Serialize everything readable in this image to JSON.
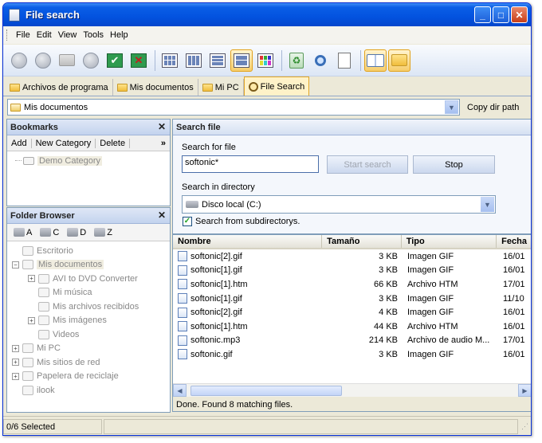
{
  "window": {
    "title": "File search"
  },
  "menu": [
    "File",
    "Edit",
    "View",
    "Tools",
    "Help"
  ],
  "toolbar": {
    "icons": [
      "back-icon",
      "forward-icon",
      "up-folder-icon",
      "refresh-icon",
      "check-icon",
      "cancel-icon",
      "large-icons-view-icon",
      "small-icons-view-icon",
      "list-view-icon",
      "details-view-icon",
      "thumbnails-view-icon",
      "recycle-icon",
      "search-icon",
      "properties-icon",
      "open-book-icon",
      "folder-icon"
    ]
  },
  "tabs": [
    "Archivos de programa",
    "Mis documentos",
    "Mi PC",
    "File Search"
  ],
  "path": {
    "value": "Mis documentos",
    "copy_label": "Copy dir path"
  },
  "bookmarks": {
    "title": "Bookmarks",
    "buttons": [
      "Add",
      "New Category",
      "Delete"
    ],
    "more": "»",
    "items": [
      "Demo Category"
    ]
  },
  "folder_browser": {
    "title": "Folder Browser",
    "drives": [
      "A",
      "C",
      "D",
      "Z"
    ],
    "tree": [
      {
        "label": "Escritorio",
        "level": 0,
        "toggle": ""
      },
      {
        "label": "Mis documentos",
        "level": 0,
        "toggle": "−",
        "selected": true
      },
      {
        "label": "AVI to DVD Converter",
        "level": 1,
        "toggle": "+"
      },
      {
        "label": "Mi música",
        "level": 1,
        "toggle": ""
      },
      {
        "label": "Mis archivos recibidos",
        "level": 1,
        "toggle": ""
      },
      {
        "label": "Mis imágenes",
        "level": 1,
        "toggle": "+"
      },
      {
        "label": "Videos",
        "level": 1,
        "toggle": ""
      },
      {
        "label": "Mi PC",
        "level": 0,
        "toggle": "+"
      },
      {
        "label": "Mis sitios de red",
        "level": 0,
        "toggle": "+"
      },
      {
        "label": "Papelera de reciclaje",
        "level": 0,
        "toggle": "+"
      },
      {
        "label": "ilook",
        "level": 0,
        "toggle": ""
      }
    ]
  },
  "search": {
    "title": "Search file",
    "for_label": "Search for file",
    "for_value": "softonic*",
    "start_label": "Start search",
    "stop_label": "Stop",
    "dir_label": "Search in directory",
    "dir_value": "Disco local (C:)",
    "subdir_label": "Search from subdirectorys.",
    "subdir_checked": true
  },
  "results": {
    "columns": [
      "Nombre",
      "Tamaño",
      "Tipo",
      "Fecha"
    ],
    "rows": [
      [
        "softonic[2].gif",
        "3 KB",
        "Imagen GIF",
        "16/01"
      ],
      [
        "softonic[1].gif",
        "3 KB",
        "Imagen GIF",
        "16/01"
      ],
      [
        "softonic[1].htm",
        "66 KB",
        "Archivo HTM",
        "17/01"
      ],
      [
        "softonic[1].gif",
        "3 KB",
        "Imagen GIF",
        "11/10"
      ],
      [
        "softonic[2].gif",
        "4 KB",
        "Imagen GIF",
        "16/01"
      ],
      [
        "softonic[1].htm",
        "44 KB",
        "Archivo HTM",
        "16/01"
      ],
      [
        "softonic.mp3",
        "214 KB",
        "Archivo de audio M...",
        "17/01"
      ],
      [
        "softonic.gif",
        "3 KB",
        "Imagen GIF",
        "16/01"
      ]
    ],
    "status": "Done. Found 8 matching files."
  },
  "statusbar": {
    "selected": "0/6 Selected"
  }
}
